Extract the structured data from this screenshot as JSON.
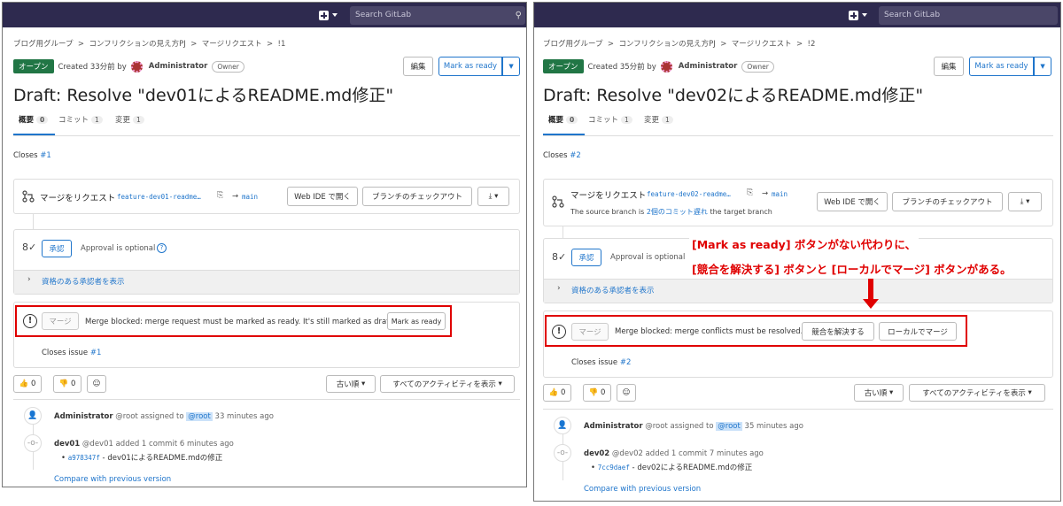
{
  "left": {
    "search_placeholder": "Search GitLab",
    "breadcrumb": [
      "ブログ用グループ",
      ">",
      "コンフリクションの見え方PJ",
      ">",
      "マージリクエスト",
      ">",
      "!1"
    ],
    "status_badge": "オープン",
    "created": "Created 33分前 by",
    "author": "Administrator",
    "role": "Owner",
    "edit_label": "編集",
    "ready_label": "Mark as ready",
    "title": "Draft: Resolve \"dev01によるREADME.md修正\"",
    "tabs": [
      {
        "label": "概要",
        "count": "0"
      },
      {
        "label": "コミット",
        "count": "1"
      },
      {
        "label": "変更",
        "count": "1"
      }
    ],
    "closes_prefix": "Closes ",
    "closes_link": "#1",
    "mr_label": "マージをリクエスト",
    "source_branch": "feature-dev01-readme…",
    "arrow": "→",
    "target_branch": "main",
    "webide_label": "Web IDE で開く",
    "checkout_label": "ブランチのチェックアウト",
    "approve_label": "承認",
    "approval_text": "Approval is optional",
    "approvers_label": "資格のある承認者を表示",
    "merge_label": "マージ",
    "blocked_text": "Merge blocked: merge request must be marked as ready. It's still marked as draft.",
    "mark_ready_label": "Mark as ready",
    "closes_issue_prefix": "Closes issue ",
    "closes_issue_link": "#1",
    "thumbs_up_count": "0",
    "thumbs_down_count": "0",
    "sort_label": "古い順",
    "filter_label": "すべてのアクティビティを表示",
    "activity1_user": "Administrator",
    "activity1_text": "@root assigned to",
    "activity1_mention": "@root",
    "activity1_time": "33 minutes ago",
    "activity2_user": "dev01",
    "activity2_text": "@dev01 added 1 commit 6 minutes ago",
    "commit_sha": "a978347f",
    "commit_msg": "- dev01によるREADME.mdの修正",
    "compare_label": "Compare with previous version"
  },
  "right": {
    "search_placeholder": "Search GitLab",
    "breadcrumb": [
      "ブログ用グループ",
      ">",
      "コンフリクションの見え方PJ",
      ">",
      "マージリクエスト",
      ">",
      "!2"
    ],
    "status_badge": "オープン",
    "created": "Created 35分前 by",
    "author": "Administrator",
    "role": "Owner",
    "edit_label": "編集",
    "ready_label": "Mark as ready",
    "title": "Draft: Resolve \"dev02によるREADME.md修正\"",
    "tabs": [
      {
        "label": "概要",
        "count": "0"
      },
      {
        "label": "コミット",
        "count": "1"
      },
      {
        "label": "変更",
        "count": "1"
      }
    ],
    "closes_prefix": "Closes ",
    "closes_link": "#2",
    "mr_label": "マージをリクエスト",
    "source_branch": "feature-dev02-readme…",
    "arrow": "→",
    "target_branch": "main",
    "behind_prefix": "The source branch is ",
    "behind_link": "2個のコミット遅れ",
    "behind_suffix": " the target branch",
    "webide_label": "Web IDE で開く",
    "checkout_label": "ブランチのチェックアウト",
    "approve_label": "承認",
    "approval_text": "Approval is optional",
    "approvers_label": "資格のある承認者を表示",
    "merge_label": "マージ",
    "blocked_text": "Merge blocked: merge conflicts must be resolved.",
    "resolve_label": "競合を解決する",
    "local_merge_label": "ローカルでマージ",
    "closes_issue_prefix": "Closes issue ",
    "closes_issue_link": "#2",
    "thumbs_up_count": "0",
    "thumbs_down_count": "0",
    "sort_label": "古い順",
    "filter_label": "すべてのアクティビティを表示",
    "activity1_user": "Administrator",
    "activity1_text": "@root assigned to",
    "activity1_mention": "@root",
    "activity1_time": "35 minutes ago",
    "activity2_user": "dev02",
    "activity2_text": "@dev02 added 1 commit 7 minutes ago",
    "commit_sha": "7cc9daef",
    "commit_msg": "- dev02によるREADME.mdの修正",
    "compare_label": "Compare with previous version",
    "annotation_line1": "[Mark as ready] ボタンがない代わりに、",
    "annotation_line2": "[競合を解決する] ボタンと [ローカルでマージ] ボタンがある。"
  },
  "icons": {
    "plus": "plus-square-icon",
    "search": "search-icon",
    "merge": "merge-request-icon",
    "copy": "copy-icon",
    "download": "download-icon",
    "approval": "approval-user-icon",
    "help": "help-icon",
    "chevron": "chevron-right-icon",
    "blocked": "exclamation-circle-icon",
    "thumbs_up": "thumbs-up-icon",
    "thumbs_down": "thumbs-down-icon",
    "emoji": "smiley-icon",
    "user": "user-icon",
    "commit": "commit-icon"
  },
  "colors": {
    "topbar": "#2e2a4f",
    "open_badge": "#217645",
    "link": "#1f75cb",
    "highlight": "#e00000"
  }
}
